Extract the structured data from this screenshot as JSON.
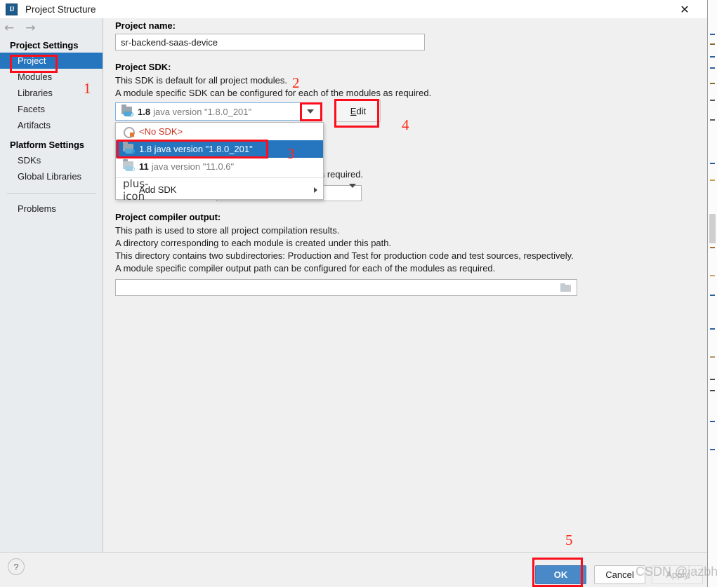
{
  "window": {
    "title": "Project Structure",
    "app_icon": "intellij-idea-icon",
    "close_icon": "✕"
  },
  "nav": {
    "back_icon": "←",
    "forward_icon": "→"
  },
  "sidebar": {
    "groups": [
      {
        "header": "Project Settings",
        "items": [
          {
            "label": "Project",
            "selected": true
          },
          {
            "label": "Modules",
            "selected": false
          },
          {
            "label": "Libraries",
            "selected": false
          },
          {
            "label": "Facets",
            "selected": false
          },
          {
            "label": "Artifacts",
            "selected": false
          }
        ]
      },
      {
        "header": "Platform Settings",
        "items": [
          {
            "label": "SDKs",
            "selected": false
          },
          {
            "label": "Global Libraries",
            "selected": false
          }
        ]
      }
    ],
    "problems_label": "Problems"
  },
  "main": {
    "project_name": {
      "label": "Project name:",
      "value": "sr-backend-saas-device"
    },
    "project_sdk": {
      "label": "Project SDK:",
      "desc_line1": "This SDK is default for all project modules.",
      "desc_line2": "A module specific SDK can be configured for each of the modules as required.",
      "selected_version": "1.8",
      "selected_desc": "java version \"1.8.0_201\"",
      "edit_button": "Edit",
      "dropdown_arrow_icon": "chevron-down-icon",
      "options": [
        {
          "label": "<No SDK>",
          "icon": "no-sdk-icon",
          "version": "",
          "desc": "",
          "highlight": false,
          "red": true
        },
        {
          "label": "1.8 java version \"1.8.0_201\"",
          "icon": "sdk-java-icon",
          "version": "1.8",
          "desc": "java version \"1.8.0_201\"",
          "highlight": true,
          "red": false
        },
        {
          "label": "11 java version \"11.0.6\"",
          "icon": "sdk-java-icon-dim",
          "version": "11",
          "desc": "java version \"11.0.6\"",
          "highlight": false,
          "red": false
        }
      ],
      "add_sdk_label": "Add SDK",
      "add_sdk_icon": "plus-icon",
      "add_sdk_submenu_icon": "chevron-right-icon"
    },
    "language_level": {
      "partial_desc": "for each of the modules as required.",
      "value": ""
    },
    "compiler_output": {
      "label": "Project compiler output:",
      "desc_line1": "This path is used to store all project compilation results.",
      "desc_line2": "A directory corresponding to each module is created under this path.",
      "desc_line3": "This directory contains two subdirectories: Production and Test for production code and test sources, respectively.",
      "desc_line4": "A module specific compiler output path can be configured for each of the modules as required.",
      "value": "",
      "browse_icon": "folder-icon"
    }
  },
  "footer": {
    "help_label": "?",
    "help_icon": "help-icon",
    "ok_label": "OK",
    "cancel_label": "Cancel",
    "apply_label": "Apply"
  },
  "annotations": {
    "numbers": [
      "1",
      "2",
      "3",
      "4",
      "5"
    ],
    "box_color": "#fc0d1c",
    "number_color": "#fc2a18"
  },
  "watermark": {
    "text": "CSDN @jazbhan"
  },
  "colors": {
    "accent_blue": "#2675bf",
    "ok_button_blue": "#4a89c8",
    "sidebar_bg": "#e8ecef",
    "dialog_bg": "#f0f0f0",
    "annotation_red": "#fc0d1c"
  }
}
